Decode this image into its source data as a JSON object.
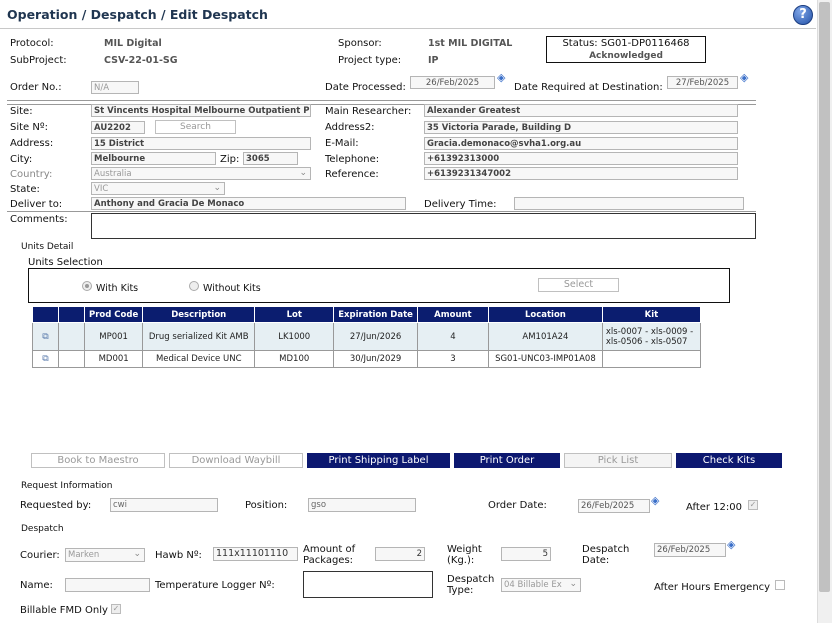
{
  "header": {
    "title": "Operation / Despatch / Edit Despatch",
    "help_glyph": "?"
  },
  "protocol": {
    "protocol_label": "Protocol:",
    "protocol_value": "MIL Digital",
    "subproject_label": "SubProject:",
    "subproject_value": "CSV-22-01-SG",
    "sponsor_label": "Sponsor:",
    "sponsor_value": "1st MIL DIGITAL",
    "project_type_label": "Project type:",
    "project_type_value": "IP",
    "status_line1": "Status: SG01-DP0116468",
    "status_line2": "Acknowledged"
  },
  "order": {
    "order_no_label": "Order No.:",
    "order_no_value": "N/A",
    "date_processed_label": "Date Processed:",
    "date_processed_value": "26/Feb/2025",
    "date_required_label": "Date Required at Destination:",
    "date_required_value": "27/Feb/2025"
  },
  "site": {
    "site_label": "Site:",
    "site_value": "St Vincents Hospital Melbourne Outpatient Pha",
    "site_no_label": "Site Nº:",
    "site_no_value": "AU2202",
    "search_label": "Search",
    "address_label": "Address:",
    "address_value": "15 District",
    "city_label": "City:",
    "city_value": "Melbourne",
    "zip_label": "Zip:",
    "zip_value": "3065",
    "country_label": "Country:",
    "country_value": "Australia",
    "state_label": "State:",
    "state_value": "VIC",
    "deliver_to_label": "Deliver to:",
    "deliver_to_value": "Anthony and Gracia De Monaco",
    "comments_label": "Comments:",
    "main_researcher_label": "Main Researcher:",
    "main_researcher_value": "Alexander Greatest",
    "address2_label": "Address2:",
    "address2_value": "35 Victoria Parade, Building D",
    "email_label": "E-Mail:",
    "email_value": "Gracia.demonaco@svha1.org.au",
    "telephone_label": "Telephone:",
    "telephone_value": "+61392313000",
    "reference_label": "Reference:",
    "reference_value": "+6139231347002",
    "delivery_time_label": "Delivery Time:"
  },
  "units": {
    "units_detail_label": "Units Detail",
    "units_selection_label": "Units Selection",
    "with_kits_label": "With Kits",
    "without_kits_label": "Without Kits",
    "select_label": "Select",
    "columns": [
      "Prod Code",
      "Description",
      "Lot",
      "Expiration Date",
      "Amount",
      "Location",
      "Kit"
    ],
    "rows": [
      {
        "prod_code": "MP001",
        "description": "Drug serialized Kit AMB",
        "lot": "LK1000",
        "expiration": "27/Jun/2026",
        "amount": "4",
        "location": "AM101A24",
        "kit": "xls-0007 - xls-0009 - xls-0506 - xls-0507"
      },
      {
        "prod_code": "MD001",
        "description": "Medical Device UNC",
        "lot": "MD100",
        "expiration": "30/Jun/2029",
        "amount": "3",
        "location": "SG01-UNC03-IMP01A08",
        "kit": ""
      }
    ]
  },
  "actions": {
    "book_to_maestro": "Book to Maestro",
    "download_waybill": "Download Waybill",
    "print_shipping_label": "Print Shipping Label",
    "print_order": "Print Order",
    "pick_list": "Pick List",
    "check_kits": "Check Kits"
  },
  "request": {
    "section_label": "Request Information",
    "requested_by_label": "Requested by:",
    "requested_by_value": "cwi",
    "position_label": "Position:",
    "position_value": "gso",
    "order_date_label": "Order Date:",
    "order_date_value": "26/Feb/2025",
    "after_1200_label": "After 12:00"
  },
  "despatch": {
    "section_label": "Despatch",
    "courier_label": "Courier:",
    "courier_value": "Marken",
    "hawb_label": "Hawb Nº:",
    "hawb_value": "111x11101110",
    "amount_packages_label_1": "Amount of",
    "amount_packages_label_2": "Packages:",
    "amount_packages_value": "2",
    "weight_label_1": "Weight",
    "weight_label_2": "(Kg.):",
    "weight_value": "5",
    "despatch_date_label_1": "Despatch",
    "despatch_date_label_2": "Date:",
    "despatch_date_value": "26/Feb/2025",
    "name_label": "Name:",
    "temp_logger_label": "Temperature Logger Nº:",
    "despatch_type_label_1": "Despatch",
    "despatch_type_label_2": "Type:",
    "despatch_type_value": "04 Billable Ex",
    "after_hours_label": "After Hours Emergency",
    "billable_fmd_label": "Billable FMD Only"
  }
}
